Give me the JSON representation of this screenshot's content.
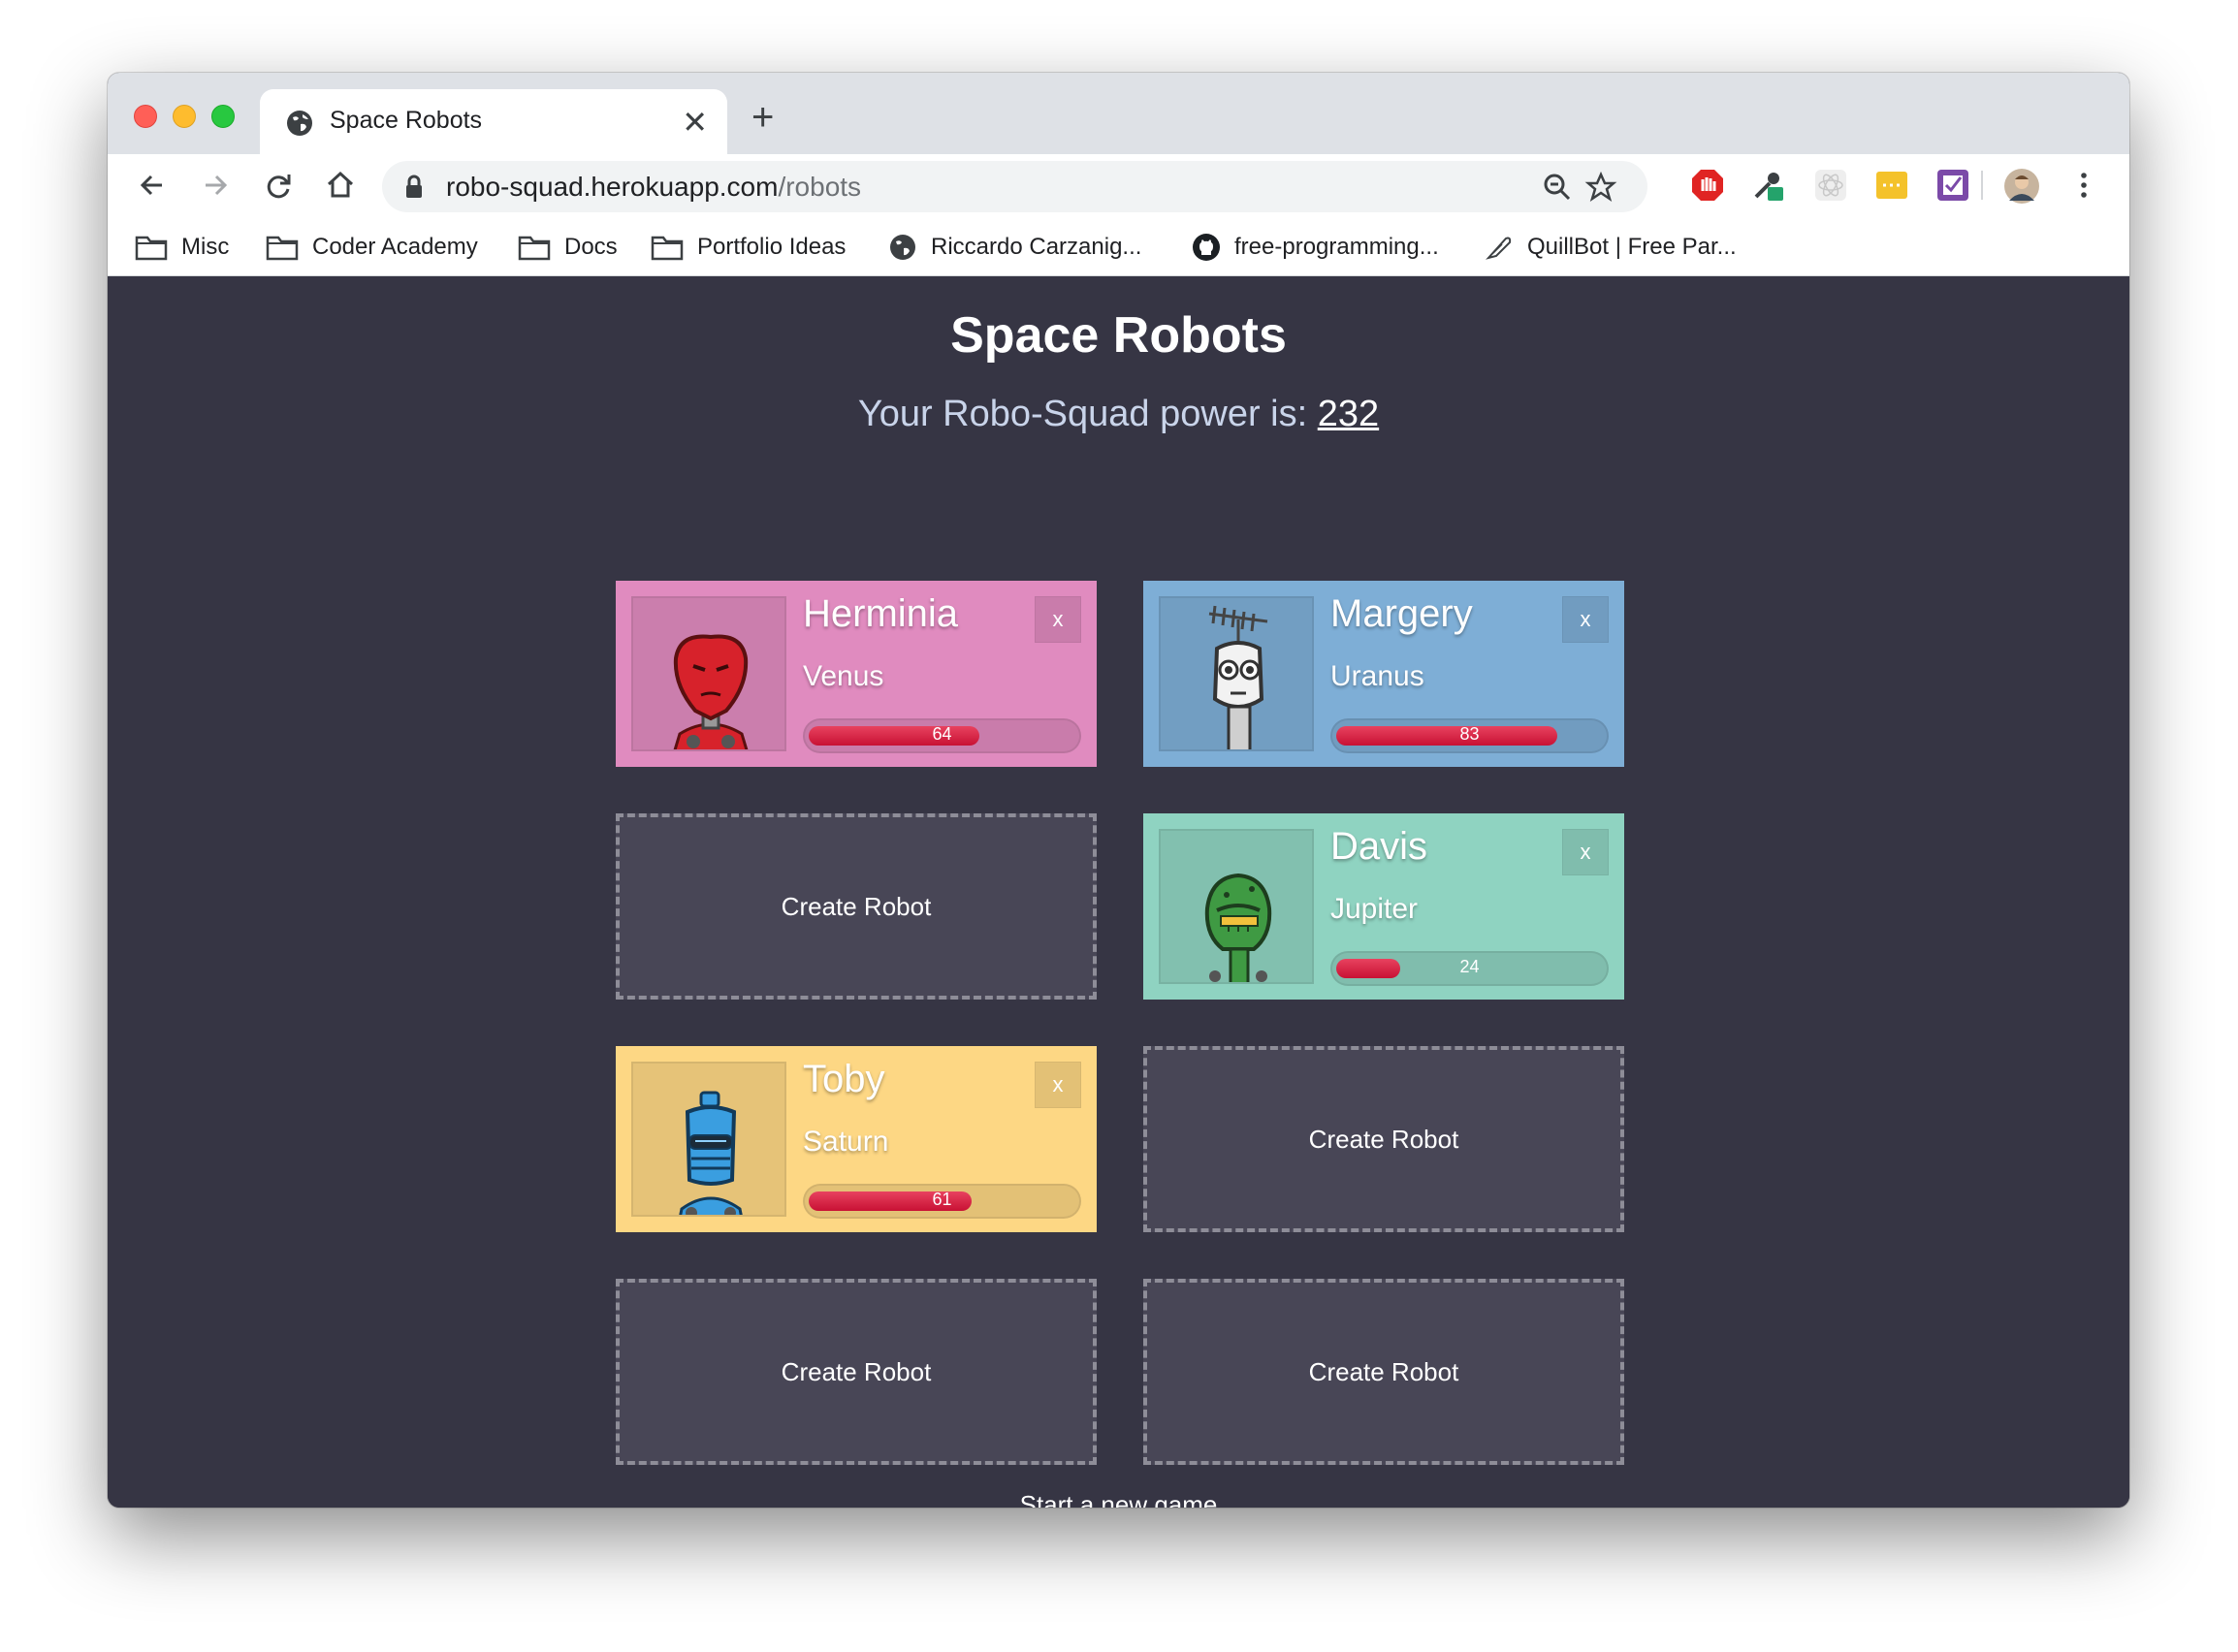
{
  "browser": {
    "tab_title": "Space Robots",
    "tab_close": "✕",
    "new_tab": "+",
    "url_host": "robo-squad.herokuapp.com",
    "url_path": "/robots"
  },
  "bookmarks": [
    {
      "label": "Misc",
      "icon": "folder-icon"
    },
    {
      "label": "Coder Academy",
      "icon": "folder-icon"
    },
    {
      "label": "Docs",
      "icon": "folder-icon"
    },
    {
      "label": "Portfolio Ideas",
      "icon": "folder-icon"
    },
    {
      "label": "Riccardo Carzanig...",
      "icon": "globe-icon"
    },
    {
      "label": "free-programming...",
      "icon": "github-icon"
    },
    {
      "label": "QuillBot | Free Par...",
      "icon": "feather-icon"
    }
  ],
  "page": {
    "title": "Space Robots",
    "power_label": "Your Robo-Squad power is: ",
    "power_value": "232",
    "new_game": "Start a new game"
  },
  "robots": [
    {
      "name": "Herminia",
      "planet": "Venus",
      "power": 64,
      "power_label": "64",
      "close": "x",
      "color": "#e08bbf",
      "robot_color": "#d7222b"
    },
    {
      "name": "Margery",
      "planet": "Uranus",
      "power": 83,
      "power_label": "83",
      "close": "x",
      "color": "#7eaed6",
      "robot_color": "#e8e8e8"
    },
    {
      "name": "Davis",
      "planet": "Jupiter",
      "power": 24,
      "power_label": "24",
      "close": "x",
      "color": "#8fd3c1",
      "robot_color": "#3f9a43"
    },
    {
      "name": "Toby",
      "planet": "Saturn",
      "power": 61,
      "power_label": "61",
      "close": "x",
      "color": "#fdd784",
      "robot_color": "#3a9ee0"
    }
  ],
  "create_label": "Create Robot"
}
